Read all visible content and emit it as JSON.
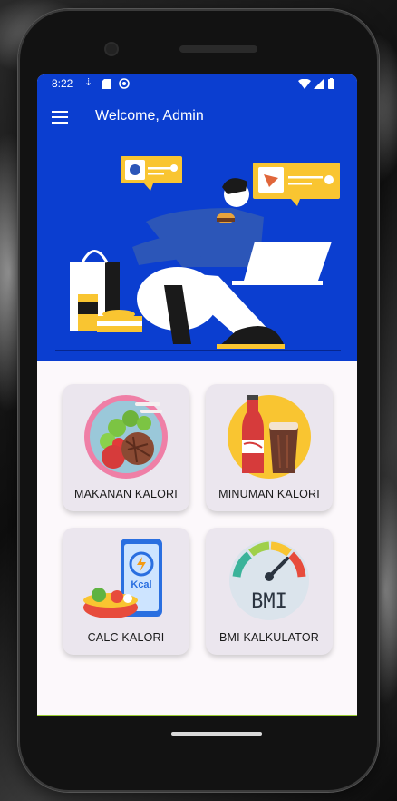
{
  "status_bar": {
    "time": "8:22",
    "icons": [
      "download-icon",
      "sd-card-icon",
      "sync-icon",
      "wifi-icon",
      "signal-icon",
      "battery-icon"
    ]
  },
  "app_bar": {
    "title": "Welcome, Admin",
    "menu_icon": "hamburger-menu-icon"
  },
  "menu_cards": [
    {
      "label": "MAKANAN KALORI",
      "icon": "food-plate-icon"
    },
    {
      "label": "MINUMAN KALORI",
      "icon": "drinks-icon"
    },
    {
      "label": "CALC KALORI",
      "icon": "kcal-phone-icon"
    },
    {
      "label": "BMI KALKULATOR",
      "icon": "bmi-gauge-icon"
    }
  ],
  "bmi_icon_text": "BMI",
  "kcal_icon_text": "Kcal",
  "colors": {
    "primary": "#0b3ed0",
    "card_bg": "#ebe6ee",
    "screen_bg": "#fcf8fb",
    "accent_yellow": "#f9c531"
  }
}
